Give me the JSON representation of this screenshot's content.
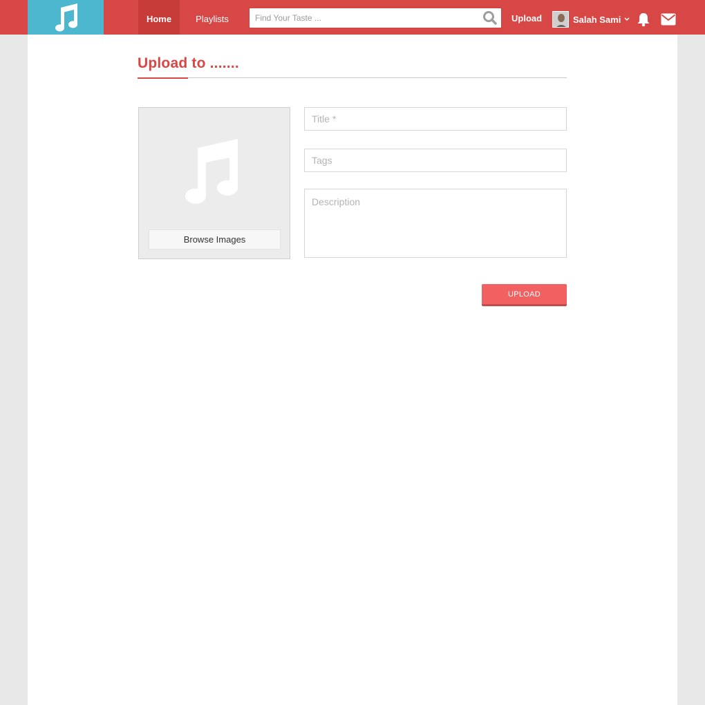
{
  "header": {
    "logo_icon": "music-note-icon",
    "nav": [
      {
        "label": "Home"
      },
      {
        "label": "Playlists"
      }
    ],
    "search": {
      "placeholder": "Find Your Taste ...",
      "icon": "search-icon"
    },
    "upload_label": "Upload",
    "user": {
      "name": "Salah Sami",
      "avatar": "avatar",
      "dropdown_icon": "chevron-down-icon"
    },
    "notifications_icon": "bell-icon",
    "messages_icon": "envelope-icon"
  },
  "page": {
    "title": "Upload to .......",
    "image_panel": {
      "placeholder_icon": "music-note-icon",
      "browse_label": "Browse Images"
    },
    "form": {
      "title_placeholder": "Title *",
      "tags_placeholder": "Tags",
      "description_placeholder": "Description",
      "submit_label": "UPLOAD"
    }
  },
  "colors": {
    "header_bg": "#d64745",
    "logo_bg": "#4cb7cf",
    "accent": "#d64745",
    "button": "#f26161"
  }
}
